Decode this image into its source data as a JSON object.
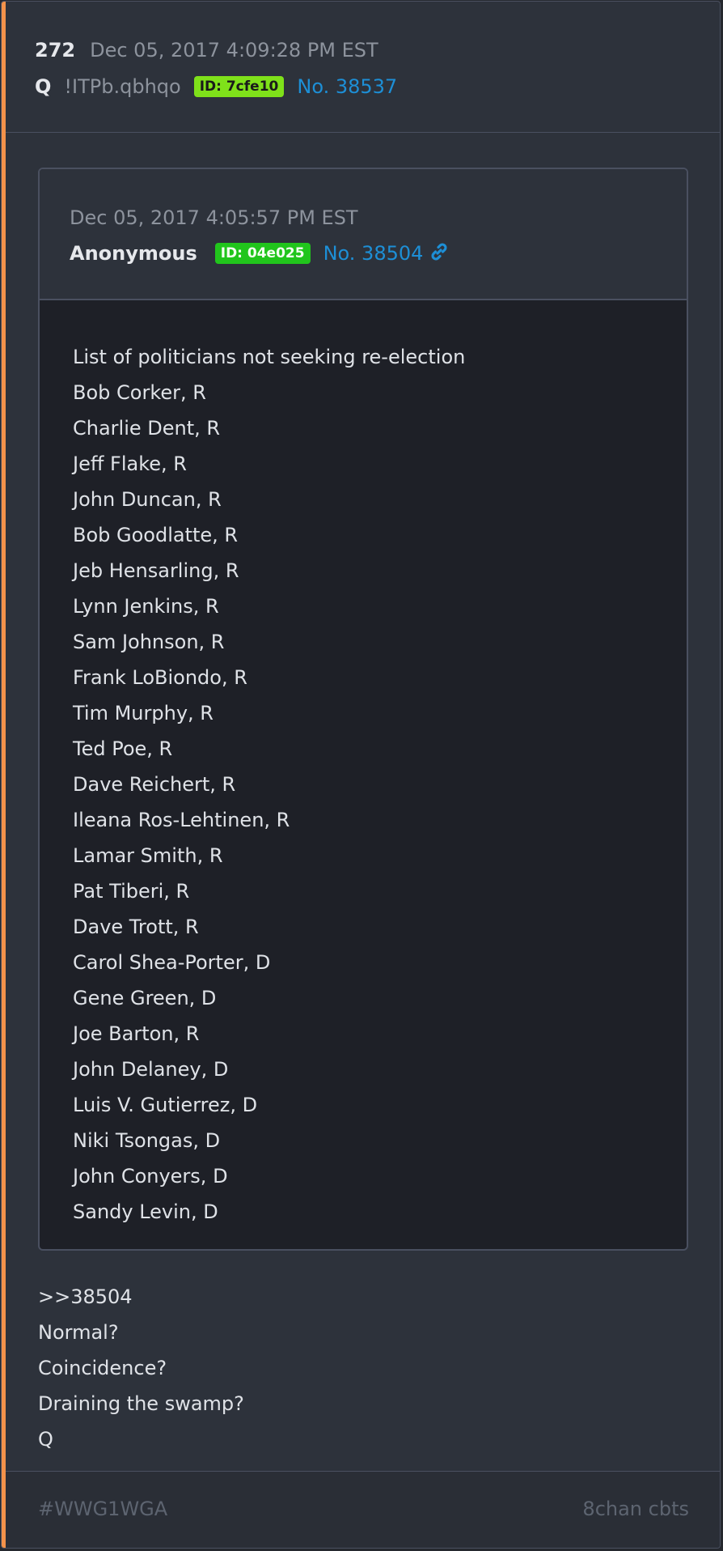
{
  "post": {
    "number": "272",
    "date": "Dec 05, 2017 4:09:28 PM EST",
    "author": "Q",
    "tripcode": "!ITPb.qbhqo",
    "id_badge": "ID: 7cfe10",
    "post_link": "No. 38537"
  },
  "quoted": {
    "date": "Dec 05, 2017 4:05:57 PM EST",
    "author": "Anonymous",
    "id_badge": "ID: 04e025",
    "post_link": "No. 38504",
    "lines": [
      "List of politicians not seeking re-election",
      "Bob Corker, R",
      "Charlie Dent, R",
      "Jeff Flake, R",
      "John Duncan, R",
      "Bob Goodlatte, R",
      "Jeb Hensarling, R",
      "Lynn Jenkins, R",
      "Sam Johnson, R",
      "Frank LoBiondo, R",
      "Tim Murphy, R",
      "Ted Poe, R",
      "Dave Reichert, R",
      "Ileana Ros-Lehtinen, R",
      "Lamar Smith, R",
      "Pat Tiberi, R",
      "Dave Trott, R",
      "Carol Shea-Porter, D",
      "Gene Green, D",
      "Joe Barton, R",
      "John Delaney, D",
      "Luis V. Gutierrez, D",
      "Niki Tsongas, D",
      "John Conyers, D",
      "Sandy Levin, D"
    ]
  },
  "reply": {
    "lines": [
      ">>38504",
      "Normal?",
      "Coincidence?",
      "Draining the swamp?",
      "Q"
    ]
  },
  "footer": {
    "hashtag": "#WWG1WGA",
    "source": "8chan cbts"
  },
  "colors": {
    "accent": "#f3924a",
    "id_q": "#7fe11a",
    "id_anon": "#21c51c",
    "link": "#1d8fd6"
  },
  "icons": {
    "permalink": "link-icon"
  }
}
